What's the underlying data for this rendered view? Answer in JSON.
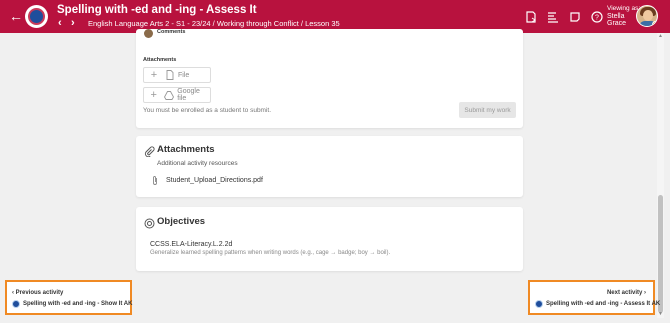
{
  "header": {
    "title": "Spelling with -ed and -ing - Assess It",
    "breadcrumb": "English Language Arts 2 - S1 - 23/24 / Working through Conflict / Lesson 35",
    "viewing_label": "Viewing as:",
    "viewing_name_first": "Stella",
    "viewing_name_last": "Grace",
    "back_icon": "arrow-left-icon",
    "prev_icon": "chevron-left-icon",
    "next_icon": "chevron-right-icon",
    "icons": [
      "assignment-icon",
      "gradebook-icon",
      "notes-icon",
      "help-icon"
    ],
    "accent": "#b8123e"
  },
  "submission": {
    "comments_label": "Comments",
    "attachments_label": "Attachments",
    "file_button": "File",
    "gdrive_button": "Google file",
    "enroll_note": "You must be enrolled as a student to submit.",
    "submit_button": "Submit my work"
  },
  "attachments": {
    "title": "Attachments",
    "subtitle": "Additional activity resources",
    "files": [
      "Student_Upload_Directions.pdf"
    ]
  },
  "objectives": {
    "title": "Objectives",
    "code": "CCSS.ELA-Literacy.L.2.2d",
    "description": "Generalize learned spelling patterns when writing words (e.g., cage → badge; boy → boil)."
  },
  "activity_nav": {
    "previous_label": "Previous activity",
    "previous_name": "Spelling with -ed and -ing - Show It AK",
    "next_label": "Next activity",
    "next_name": "Spelling with -ed and -ing - Assess It AK",
    "highlight_color": "#f08a24"
  }
}
